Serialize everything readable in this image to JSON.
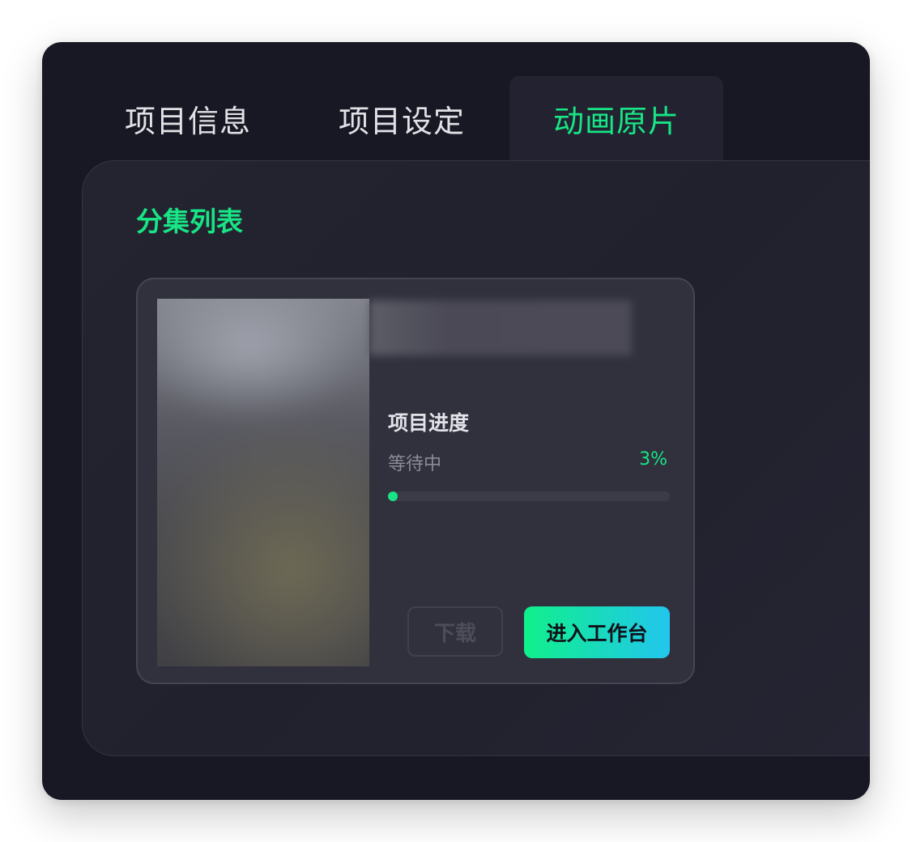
{
  "tabs": [
    {
      "label": "项目信息",
      "active": false
    },
    {
      "label": "项目设定",
      "active": false
    },
    {
      "label": "动画原片",
      "active": true
    }
  ],
  "section": {
    "title": "分集列表"
  },
  "episode_card": {
    "progress_title": "项目进度",
    "status": "等待中",
    "percent_label": "3%",
    "progress_value": 0.03,
    "download_label": "下载",
    "enter_label": "进入工作台"
  },
  "colors": {
    "accent": "#18e585",
    "window_bg": "#181824",
    "panel_bg": "#222230",
    "card_bg": "#31313e",
    "button_gradient_start": "#10f08b",
    "button_gradient_end": "#22c6ee"
  }
}
